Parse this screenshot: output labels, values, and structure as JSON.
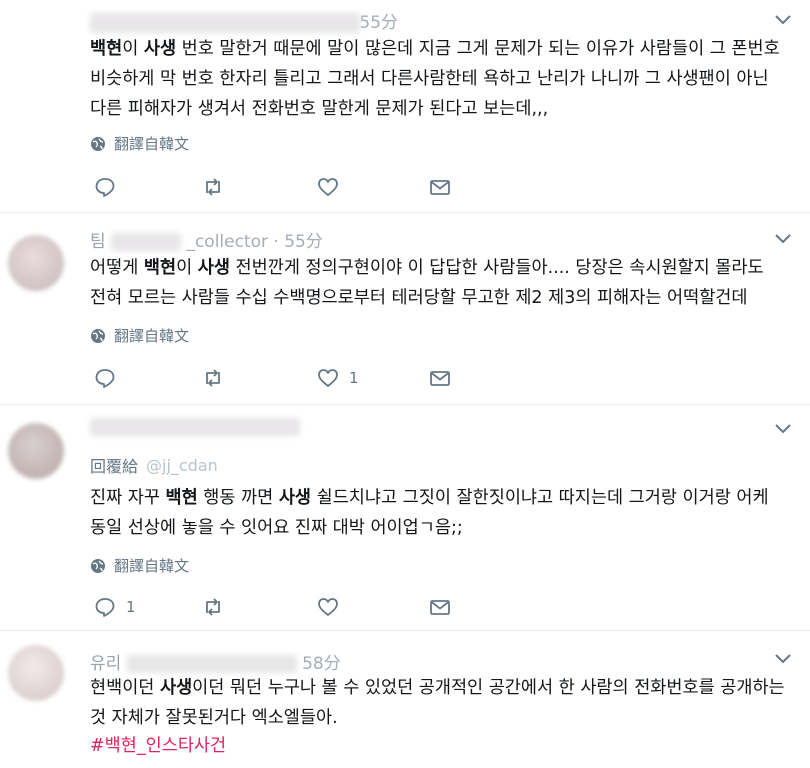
{
  "tweets": [
    {
      "header_tail": "55分",
      "segments_a": [
        {
          "b": "백현",
          "t": "이 "
        },
        {
          "b": "사생",
          "t": " 번호 말한거 때문에 말이 많은데 지금 그게 문제가 되는 이유가 사람들이 그 폰번호 비슷하게 막 번호 한자리 틀리고 그래서 다른사람한테 욕하고 난리가 나니까 그 사생팬이 아닌 다른 피해자가 생겨서 전화번호 말한게 문제가 된다고 보는데,,,"
        }
      ],
      "translate": "翻譯自韓文",
      "reply_count": "",
      "retweet_count": "",
      "like_count": ""
    },
    {
      "header_name": "팀",
      "header_handle": "_collector",
      "header_tail": "· 55分",
      "text_prefix": "어떻게 ",
      "b1": "백현",
      "mid1": "이 ",
      "b2": "사생",
      "rest": " 전번깐게 정의구현이야 이 답답한 사람들아.... 당장은 속시원할지 몰라도 전혀 모르는 사람들 수십 수백명으로부터 테러당할 무고한 제2 제3의 피해자는 어떡할건데",
      "translate": "翻譯自韓文",
      "like_count": "1"
    },
    {
      "reply_label": "回覆給",
      "mention": "@jj_cdan",
      "text_prefix": "진짜 자꾸 ",
      "b1": "백현",
      "mid1": " 행동 까면 ",
      "b2": "사생",
      "rest": " 쉴드치냐고 그짓이 잘한짓이냐고 따지는데 그거랑 이거랑 어케 동일 선상에 놓을 수 잇어요 진짜 대박 어이업ㄱ음;;",
      "translate": "翻譯自韓文",
      "reply_count": "1"
    },
    {
      "header_name": "유리",
      "header_tail": "58分",
      "text_prefix": "현백이던 ",
      "b1": "사생",
      "rest": "이던 뭐던 누구나 볼 수 있었던 공개적인 공간에서 한 사람의 전화번호를 공개하는 것 자체가 잘못된거다 엑소엘들아.",
      "hashtag": "#백현_인스타사건"
    }
  ]
}
